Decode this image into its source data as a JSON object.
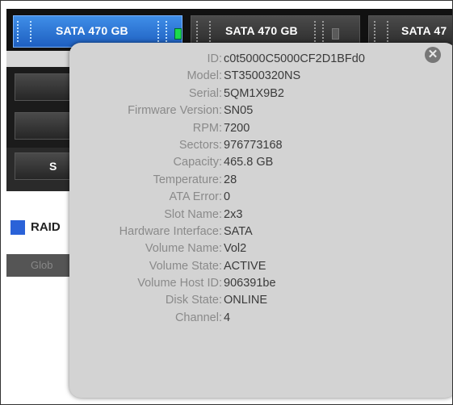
{
  "drives": [
    {
      "label": "SATA 470 GB",
      "selected": true
    },
    {
      "label": "SATA 470 GB",
      "selected": false
    },
    {
      "label": "SATA 47",
      "selected": false
    }
  ],
  "lower_drive_fragments": [
    "S",
    "("
  ],
  "raid": {
    "label": "RAID"
  },
  "global_bar": {
    "text": "Glob"
  },
  "popup": {
    "close_icon": "close-icon",
    "rows": [
      {
        "key": "ID:",
        "value": "c0t5000C5000CF2D1BFd0"
      },
      {
        "key": "Model:",
        "value": "ST3500320NS"
      },
      {
        "key": "Serial:",
        "value": "5QM1X9B2"
      },
      {
        "key": "Firmware Version:",
        "value": "SN05"
      },
      {
        "key": "RPM:",
        "value": "7200"
      },
      {
        "key": "Sectors:",
        "value": "976773168"
      },
      {
        "key": "Capacity:",
        "value": "465.8 GB"
      },
      {
        "key": "Temperature:",
        "value": "28"
      },
      {
        "key": "ATA Error:",
        "value": "0"
      },
      {
        "key": "Slot Name:",
        "value": "2x3"
      },
      {
        "key": "Hardware Interface:",
        "value": "SATA"
      },
      {
        "key": "Volume Name:",
        "value": "Vol2"
      },
      {
        "key": "Volume State:",
        "value": "ACTIVE"
      },
      {
        "key": "Volume Host ID:",
        "value": "906391be"
      },
      {
        "key": "Disk State:",
        "value": "ONLINE"
      },
      {
        "key": "Channel:",
        "value": "4"
      }
    ]
  }
}
